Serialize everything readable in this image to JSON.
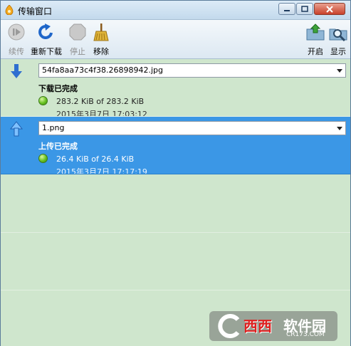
{
  "window": {
    "title": "传输窗口"
  },
  "toolbar": {
    "resume": "续传",
    "redownload": "重新下载",
    "stop": "停止",
    "remove": "移除",
    "open": "开启",
    "show": "显示"
  },
  "transfers": [
    {
      "direction": "download",
      "file": "54fa8aa73c4f38.26898942.jpg",
      "status": "下载已完成",
      "size": "283.2 KiB of 283.2 KiB",
      "time": "2015年3月7日 17:03:12",
      "selected": false
    },
    {
      "direction": "upload",
      "file": "1.png",
      "status": "上传已完成",
      "size": "26.4 KiB of 26.4 KiB",
      "time": "2015年3月7日 17:17:19",
      "selected": true
    }
  ],
  "watermark": {
    "brand": "西西",
    "brand2": "软件园",
    "url": "CR173.COM"
  },
  "colors": {
    "selected_row": "#3b97e6",
    "list_bg": "#cfe6cd",
    "status_ok": "#66c020"
  }
}
